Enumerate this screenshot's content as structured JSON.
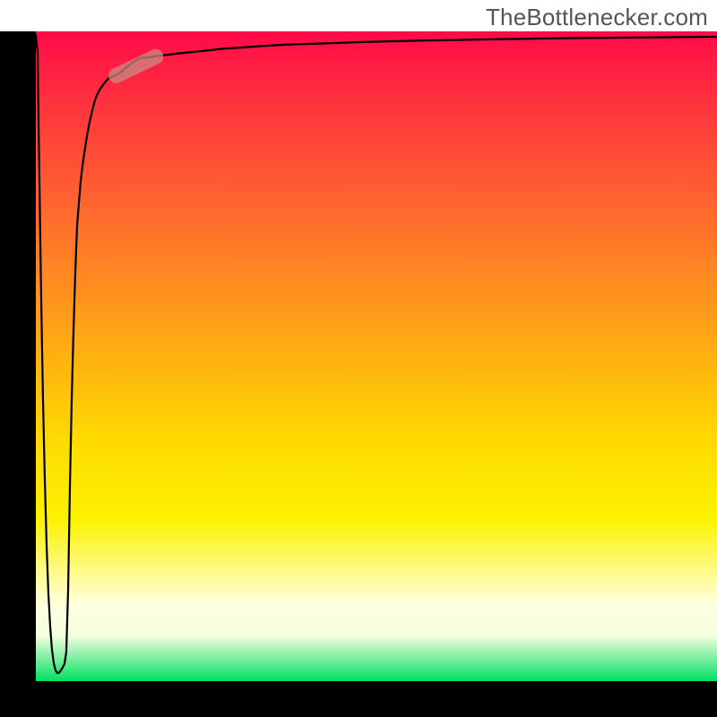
{
  "watermark": "TheBottlenecker.com",
  "chart_data": {
    "type": "line",
    "title": "",
    "xlabel": "",
    "ylabel": "",
    "xlim": [
      0,
      100
    ],
    "ylim": [
      0,
      100
    ],
    "series": [
      {
        "name": "bottleneck-curve",
        "x": [
          0.0,
          0.26,
          0.53,
          0.79,
          1.05,
          1.32,
          1.58,
          1.84,
          2.11,
          2.37,
          2.63,
          2.89,
          3.16,
          3.42,
          3.68,
          3.95,
          4.21,
          4.47,
          4.74,
          5.0,
          5.26,
          5.53,
          5.79,
          6.05,
          6.32,
          6.58,
          6.84,
          7.11,
          7.37,
          7.63,
          7.89,
          8.16,
          8.42,
          8.68,
          8.95,
          9.21,
          9.47,
          9.74,
          10.0,
          10.53,
          11.05,
          11.58,
          12.11,
          12.63,
          13.16,
          13.68,
          14.21,
          14.74,
          15.26,
          15.79,
          16.84,
          17.89,
          18.95,
          20.0,
          21.05,
          22.37,
          23.68,
          25.0,
          27.63,
          30.26,
          32.89,
          36.84,
          42.11,
          47.37,
          55.26,
          65.79,
          78.95,
          100.0
        ],
        "y": [
          99.5,
          96.69,
          76.55,
          58.62,
          43.31,
          30.76,
          20.9,
          13.52,
          8.28,
          4.83,
          2.76,
          1.66,
          1.24,
          1.31,
          1.66,
          2.14,
          2.69,
          4.48,
          14.07,
          29.86,
          43.17,
          54.07,
          62.9,
          70.0,
          73.59,
          76.9,
          79.24,
          81.24,
          83.03,
          84.62,
          86.03,
          87.28,
          88.41,
          89.41,
          90.14,
          90.69,
          91.17,
          91.59,
          91.97,
          92.62,
          92.97,
          93.17,
          93.45,
          93.86,
          94.34,
          94.76,
          95.17,
          95.59,
          95.86,
          95.93,
          96.07,
          96.21,
          96.34,
          96.48,
          96.62,
          96.76,
          96.9,
          97.03,
          97.34,
          97.52,
          97.72,
          97.97,
          98.14,
          98.34,
          98.55,
          98.76,
          98.97,
          99.17
        ]
      }
    ],
    "highlight_segment": {
      "x_start": 11.8,
      "y_start": 93.2,
      "x_end": 17.6,
      "y_end": 96.1
    },
    "background_gradient_stops": [
      {
        "pos": 0.0,
        "color": "#ff0a48"
      },
      {
        "pos": 0.28,
        "color": "#ff6a2d"
      },
      {
        "pos": 0.62,
        "color": "#fed800"
      },
      {
        "pos": 0.88,
        "color": "#ffffdc"
      },
      {
        "pos": 1.0,
        "color": "#00e060"
      }
    ],
    "colors": {
      "axis": "#000000",
      "curve": "#000000",
      "highlight": "#c98d85"
    }
  }
}
